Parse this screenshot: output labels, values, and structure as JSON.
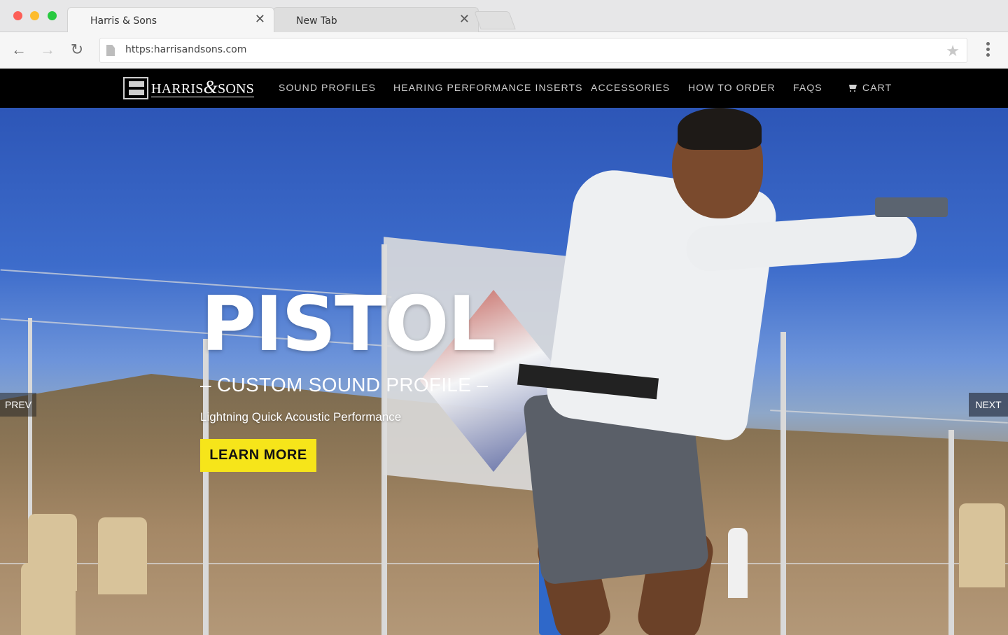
{
  "browser": {
    "tabs": [
      {
        "title": "Harris & Sons"
      },
      {
        "title": "New Tab"
      }
    ],
    "url": "https:harrisandsons.com"
  },
  "site": {
    "logo_text": {
      "part1": "HARRIS",
      "amp": "&",
      "part2": "SONS"
    },
    "nav": [
      {
        "label": "SOUND PROFILES"
      },
      {
        "label": "HEARING PERFORMANCE INSERTS"
      },
      {
        "label": "ACCESSORIES"
      },
      {
        "label": "HOW TO ORDER"
      },
      {
        "label": "FAQS"
      },
      {
        "label": "CART",
        "icon": "cart-icon"
      }
    ]
  },
  "hero": {
    "title": "PISTOL",
    "subtitle": "– CUSTOM SOUND PROFILE –",
    "description": "Lightning Quick Acoustic Performance",
    "cta_label": "LEARN MORE",
    "prev_label": "PREV",
    "next_label": "NEXT"
  },
  "colors": {
    "nav_background": "#000000",
    "cta_background": "#f6e51a",
    "nav_text": "#cfcfcf"
  }
}
